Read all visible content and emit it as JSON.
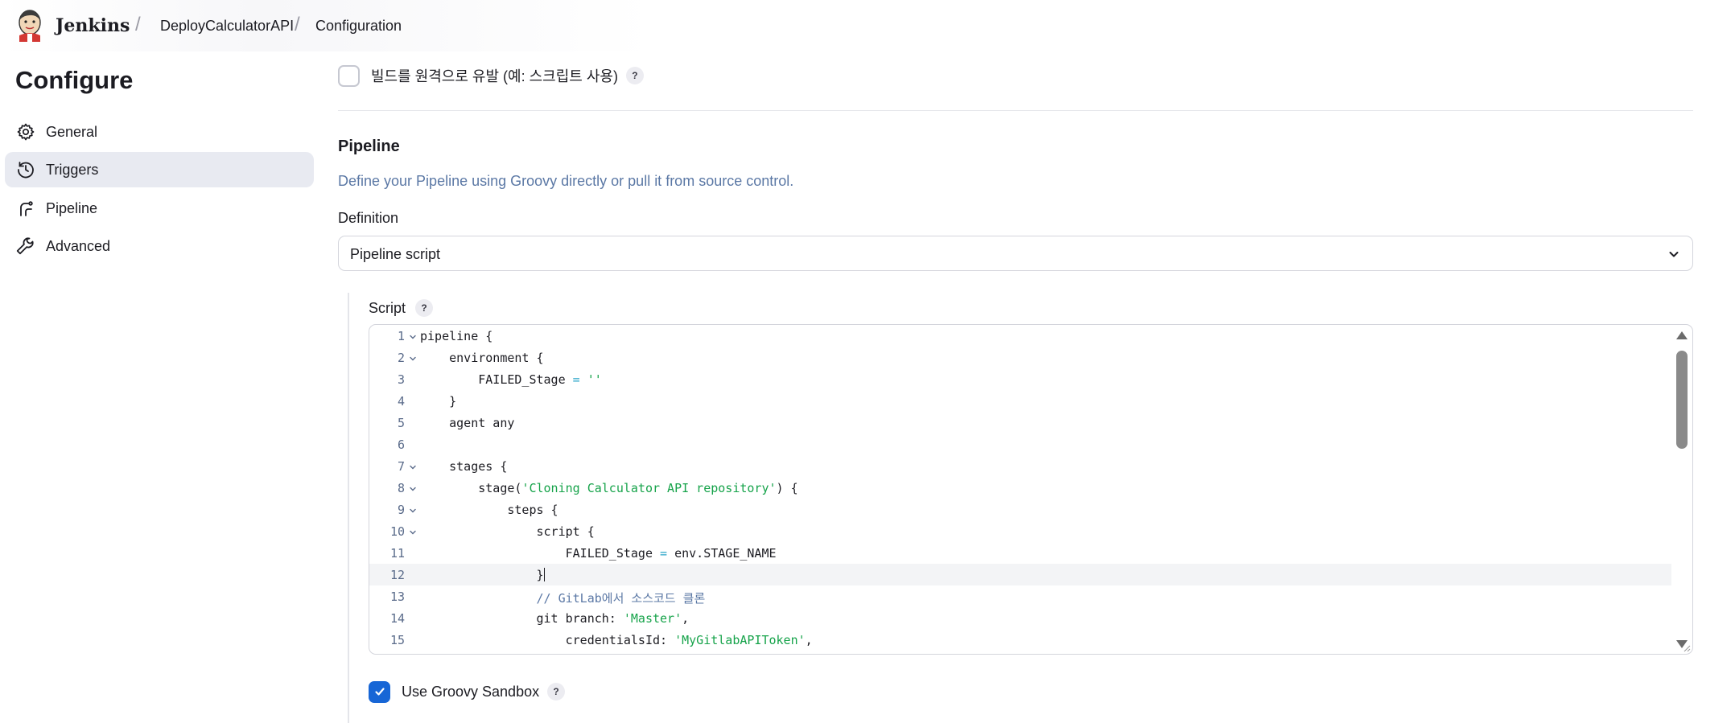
{
  "header": {
    "brand": "Jenkins",
    "breadcrumbs": [
      "DeployCalculatorAPI",
      "Configuration"
    ]
  },
  "sidebar": {
    "title": "Configure",
    "items": [
      {
        "label": "General",
        "icon": "gear-icon"
      },
      {
        "label": "Triggers",
        "icon": "clock-icon",
        "active": true
      },
      {
        "label": "Pipeline",
        "icon": "pipeline-icon"
      },
      {
        "label": "Advanced",
        "icon": "wrench-icon"
      }
    ]
  },
  "main": {
    "remote_trigger_label": "빌드를 원격으로 유발 (예: 스크립트 사용)",
    "remote_trigger_checked": false,
    "help_glyph": "?",
    "pipeline_section": {
      "title": "Pipeline",
      "description": "Define your Pipeline using Groovy directly or pull it from source control.",
      "definition_label": "Definition",
      "definition_value": "Pipeline script"
    },
    "script": {
      "label": "Script",
      "lines": [
        {
          "n": "1",
          "fold": true,
          "text": "pipeline {"
        },
        {
          "n": "2",
          "fold": true,
          "text": "    environment {"
        },
        {
          "n": "3",
          "fold": false,
          "text": "        FAILED_Stage = ''"
        },
        {
          "n": "4",
          "fold": false,
          "text": "    }"
        },
        {
          "n": "5",
          "fold": false,
          "text": "    agent any"
        },
        {
          "n": "6",
          "fold": false,
          "text": ""
        },
        {
          "n": "7",
          "fold": true,
          "text": "    stages {"
        },
        {
          "n": "8",
          "fold": true,
          "text": "        stage('Cloning Calculator API repository') {"
        },
        {
          "n": "9",
          "fold": true,
          "text": "            steps {"
        },
        {
          "n": "10",
          "fold": true,
          "text": "                script {"
        },
        {
          "n": "11",
          "fold": false,
          "text": "                    FAILED_Stage = env.STAGE_NAME"
        },
        {
          "n": "12",
          "fold": false,
          "text": "                }",
          "current": true
        },
        {
          "n": "13",
          "fold": false,
          "text": "                // GitLab에서 소스코드 클론"
        },
        {
          "n": "14",
          "fold": false,
          "text": "                git branch: 'Master',"
        },
        {
          "n": "15",
          "fold": false,
          "text": "                    credentialsId: 'MyGitlabAPIToken',"
        }
      ]
    },
    "sandbox": {
      "label": "Use Groovy Sandbox",
      "checked": true
    }
  },
  "colors": {
    "accent": "#1766d6",
    "active_nav_bg": "#e8eaf1",
    "string": "#16a34a",
    "comment": "#5b78a5",
    "operator": "#2aa5c8"
  }
}
